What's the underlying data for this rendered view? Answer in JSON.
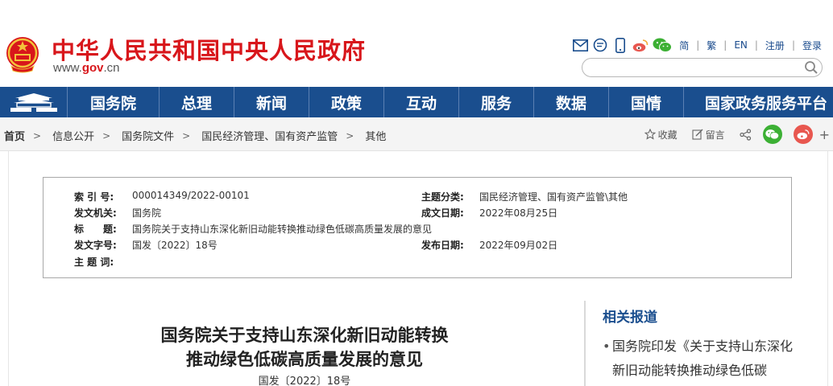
{
  "header": {
    "site_title": "中华人民共和国中央人民政府",
    "domain_prefix": "www.",
    "domain_name": "gov",
    "domain_suffix": ".cn",
    "search_placeholder": ""
  },
  "top_tools": {
    "icons": [
      "email-icon",
      "message-icon",
      "mobile-icon",
      "weibo-icon",
      "wechat-icon"
    ],
    "links": [
      "简",
      "繁",
      "EN",
      "注册",
      "登录"
    ]
  },
  "nav": {
    "items": [
      "国务院",
      "总理",
      "新闻",
      "政策",
      "互动",
      "服务",
      "数据",
      "国情",
      "国家政务服务平台"
    ]
  },
  "breadcrumb": {
    "items": [
      "首页",
      "信息公开",
      "国务院文件",
      "国民经济管理、国有资产监管",
      "其他"
    ],
    "actions": {
      "favorite": "收藏",
      "comment": "留言"
    },
    "plus": "+"
  },
  "doc_info": {
    "left": [
      {
        "key": "索 引 号:",
        "value": "000014349/2022-00101"
      },
      {
        "key": "发文机关:",
        "value": "国务院"
      },
      {
        "key": "标　　题:",
        "value": "国务院关于支持山东深化新旧动能转换推动绿色低碳高质量发展的意见"
      },
      {
        "key": "发文字号:",
        "value": "国发〔2022〕18号"
      },
      {
        "key": "主 题 词:",
        "value": ""
      }
    ],
    "right": [
      {
        "key": "主题分类:",
        "value": "国民经济管理、国有资产监管\\其他"
      },
      {
        "key": "成文日期:",
        "value": "2022年08月25日"
      },
      {
        "key": "发布日期:",
        "value": "2022年09月02日"
      }
    ]
  },
  "article": {
    "title_line1": "国务院关于支持山东深化新旧动能转换",
    "title_line2": "推动绿色低碳高质量发展的意见",
    "doc_number": "国发〔2022〕18号"
  },
  "sidebar": {
    "title": "相关报道",
    "link1": "国务院印发《关于支持山东深化新旧动能转换推动绿色低碳",
    "bullet": "•"
  },
  "colors": {
    "brand_red": "#d8161b",
    "nav_blue": "#1a4e8e",
    "wechat_green": "#3cb034",
    "weibo_red": "#e8574f"
  }
}
